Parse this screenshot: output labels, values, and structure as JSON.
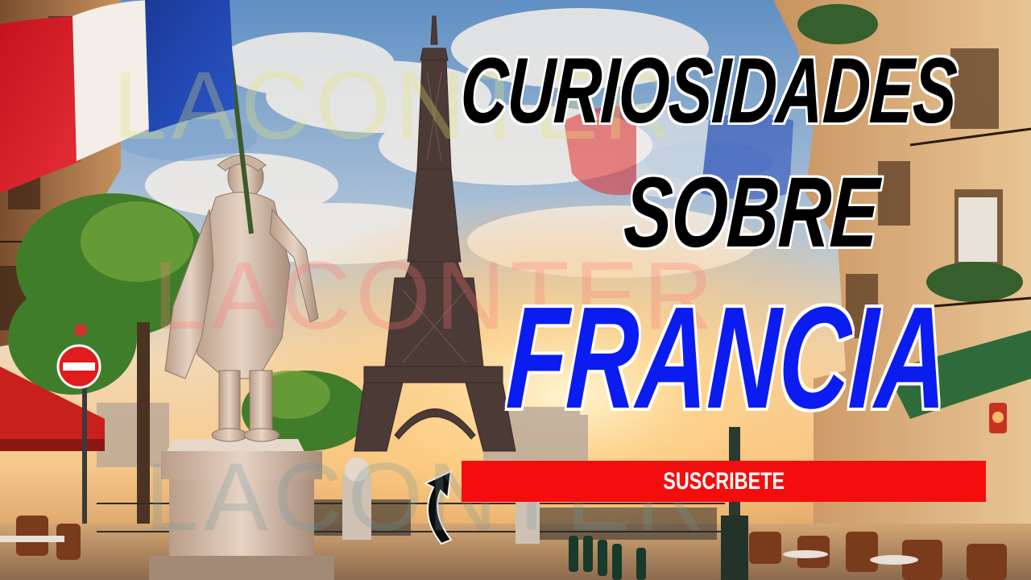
{
  "thumbnail": {
    "headline": {
      "line1": "CURIOSIDADES",
      "line2": "SOBRE",
      "line3": "FRANCIA"
    },
    "subscribe_label": "SUSCRIBETE",
    "watermark_text": "LACONTER",
    "colors": {
      "headline_black": "#000000",
      "headline_outline": "#ffffff",
      "headline_blue": "#0b1cf0",
      "subscribe_bg": "#f40d0d",
      "flag_blue": "#1c3f9e",
      "flag_white": "#f5f3ee",
      "flag_red": "#e0202a"
    },
    "icons": [
      "french-flag",
      "eiffel-tower",
      "statue",
      "curved-arrow-icon",
      "no-entry-sign"
    ]
  }
}
